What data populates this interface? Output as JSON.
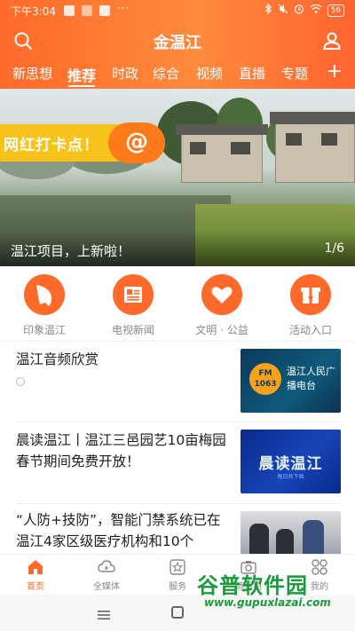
{
  "status_bar": {
    "time": "下午3:04",
    "dots": "···",
    "battery": "56"
  },
  "header": {
    "title": "金温江",
    "tabs": [
      {
        "label": "新思想"
      },
      {
        "label": "推荐"
      },
      {
        "label": "时政"
      },
      {
        "label": "综合"
      },
      {
        "label": "视频"
      },
      {
        "label": "直播"
      },
      {
        "label": "专题"
      }
    ],
    "active_tab": "推荐",
    "add_label": "+"
  },
  "banner": {
    "stamp_text": "网红打卡点！",
    "stamp_symbol": "@",
    "caption": "温江项目，上新啦！",
    "pager": "1/6"
  },
  "quick_links": [
    {
      "label": "印象温江",
      "icon": "map-icon"
    },
    {
      "label": "电视新闻",
      "icon": "news-icon"
    },
    {
      "label": "文明 · 公益",
      "icon": "heart-icon"
    },
    {
      "label": "活动入口",
      "icon": "gift-icon"
    }
  ],
  "news": [
    {
      "title": "温江音频欣赏",
      "thumb": {
        "badge": "FM 1063",
        "text": "温江人民广播电台"
      }
    },
    {
      "title": "晨读温江丨温江三邑园艺10亩梅园春节期间免费开放！",
      "thumb": {
        "text": "晨读温江",
        "sub": "每日共下阅"
      }
    },
    {
      "title": "“人防+技防”，智能门禁系统已在温江4家区级医疗机构和10个",
      "thumb": {}
    }
  ],
  "bottom_nav": [
    {
      "label": "首页",
      "icon": "home-icon"
    },
    {
      "label": "全媒体",
      "icon": "media-icon"
    },
    {
      "label": "服务",
      "icon": "star-icon"
    },
    {
      "label": "随手拍",
      "icon": "camera-icon"
    },
    {
      "label": "我的",
      "icon": "grid-icon"
    }
  ],
  "active_nav": "首页",
  "watermark": {
    "main": "谷普软件园",
    "url": "www.gupuxlazai.com"
  },
  "colors": {
    "accent": "#ff6a2a",
    "stamp": "#f7c21a",
    "watermark": "#1a9a3a"
  }
}
